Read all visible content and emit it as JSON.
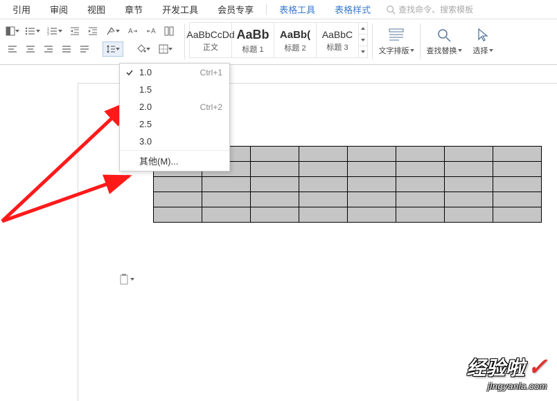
{
  "menubar": {
    "items": [
      "引用",
      "审阅",
      "视图",
      "章节",
      "开发工具",
      "会员专享"
    ],
    "context_items": [
      "表格工具",
      "表格样式"
    ],
    "search_placeholder": "查找命令、搜索模板"
  },
  "styles": {
    "items": [
      {
        "preview": "AaBbCcDd",
        "label": "正文",
        "cls": ""
      },
      {
        "preview": "AaBb",
        "label": "标题 1",
        "cls": "bold"
      },
      {
        "preview": "AaBb(",
        "label": "标题 2",
        "cls": "h2"
      },
      {
        "preview": "AaBbC",
        "label": "标题 3",
        "cls": "h3"
      }
    ]
  },
  "big_buttons": {
    "layout": "文字排版",
    "find": "查找替换",
    "select": "选择"
  },
  "dropdown": {
    "items": [
      {
        "label": "1.0",
        "shortcut": "Ctrl+1",
        "checked": true,
        "border": false
      },
      {
        "label": "1.5",
        "shortcut": "",
        "checked": false,
        "border": false
      },
      {
        "label": "2.0",
        "shortcut": "Ctrl+2",
        "checked": false,
        "border": false
      },
      {
        "label": "2.5",
        "shortcut": "",
        "checked": false,
        "border": false
      },
      {
        "label": "3.0",
        "shortcut": "",
        "checked": false,
        "border": true
      },
      {
        "label": "其他(M)...",
        "shortcut": "",
        "checked": false,
        "border": false
      }
    ]
  },
  "watermark": {
    "main": "经验啦",
    "sub": "jingyanla.com"
  }
}
